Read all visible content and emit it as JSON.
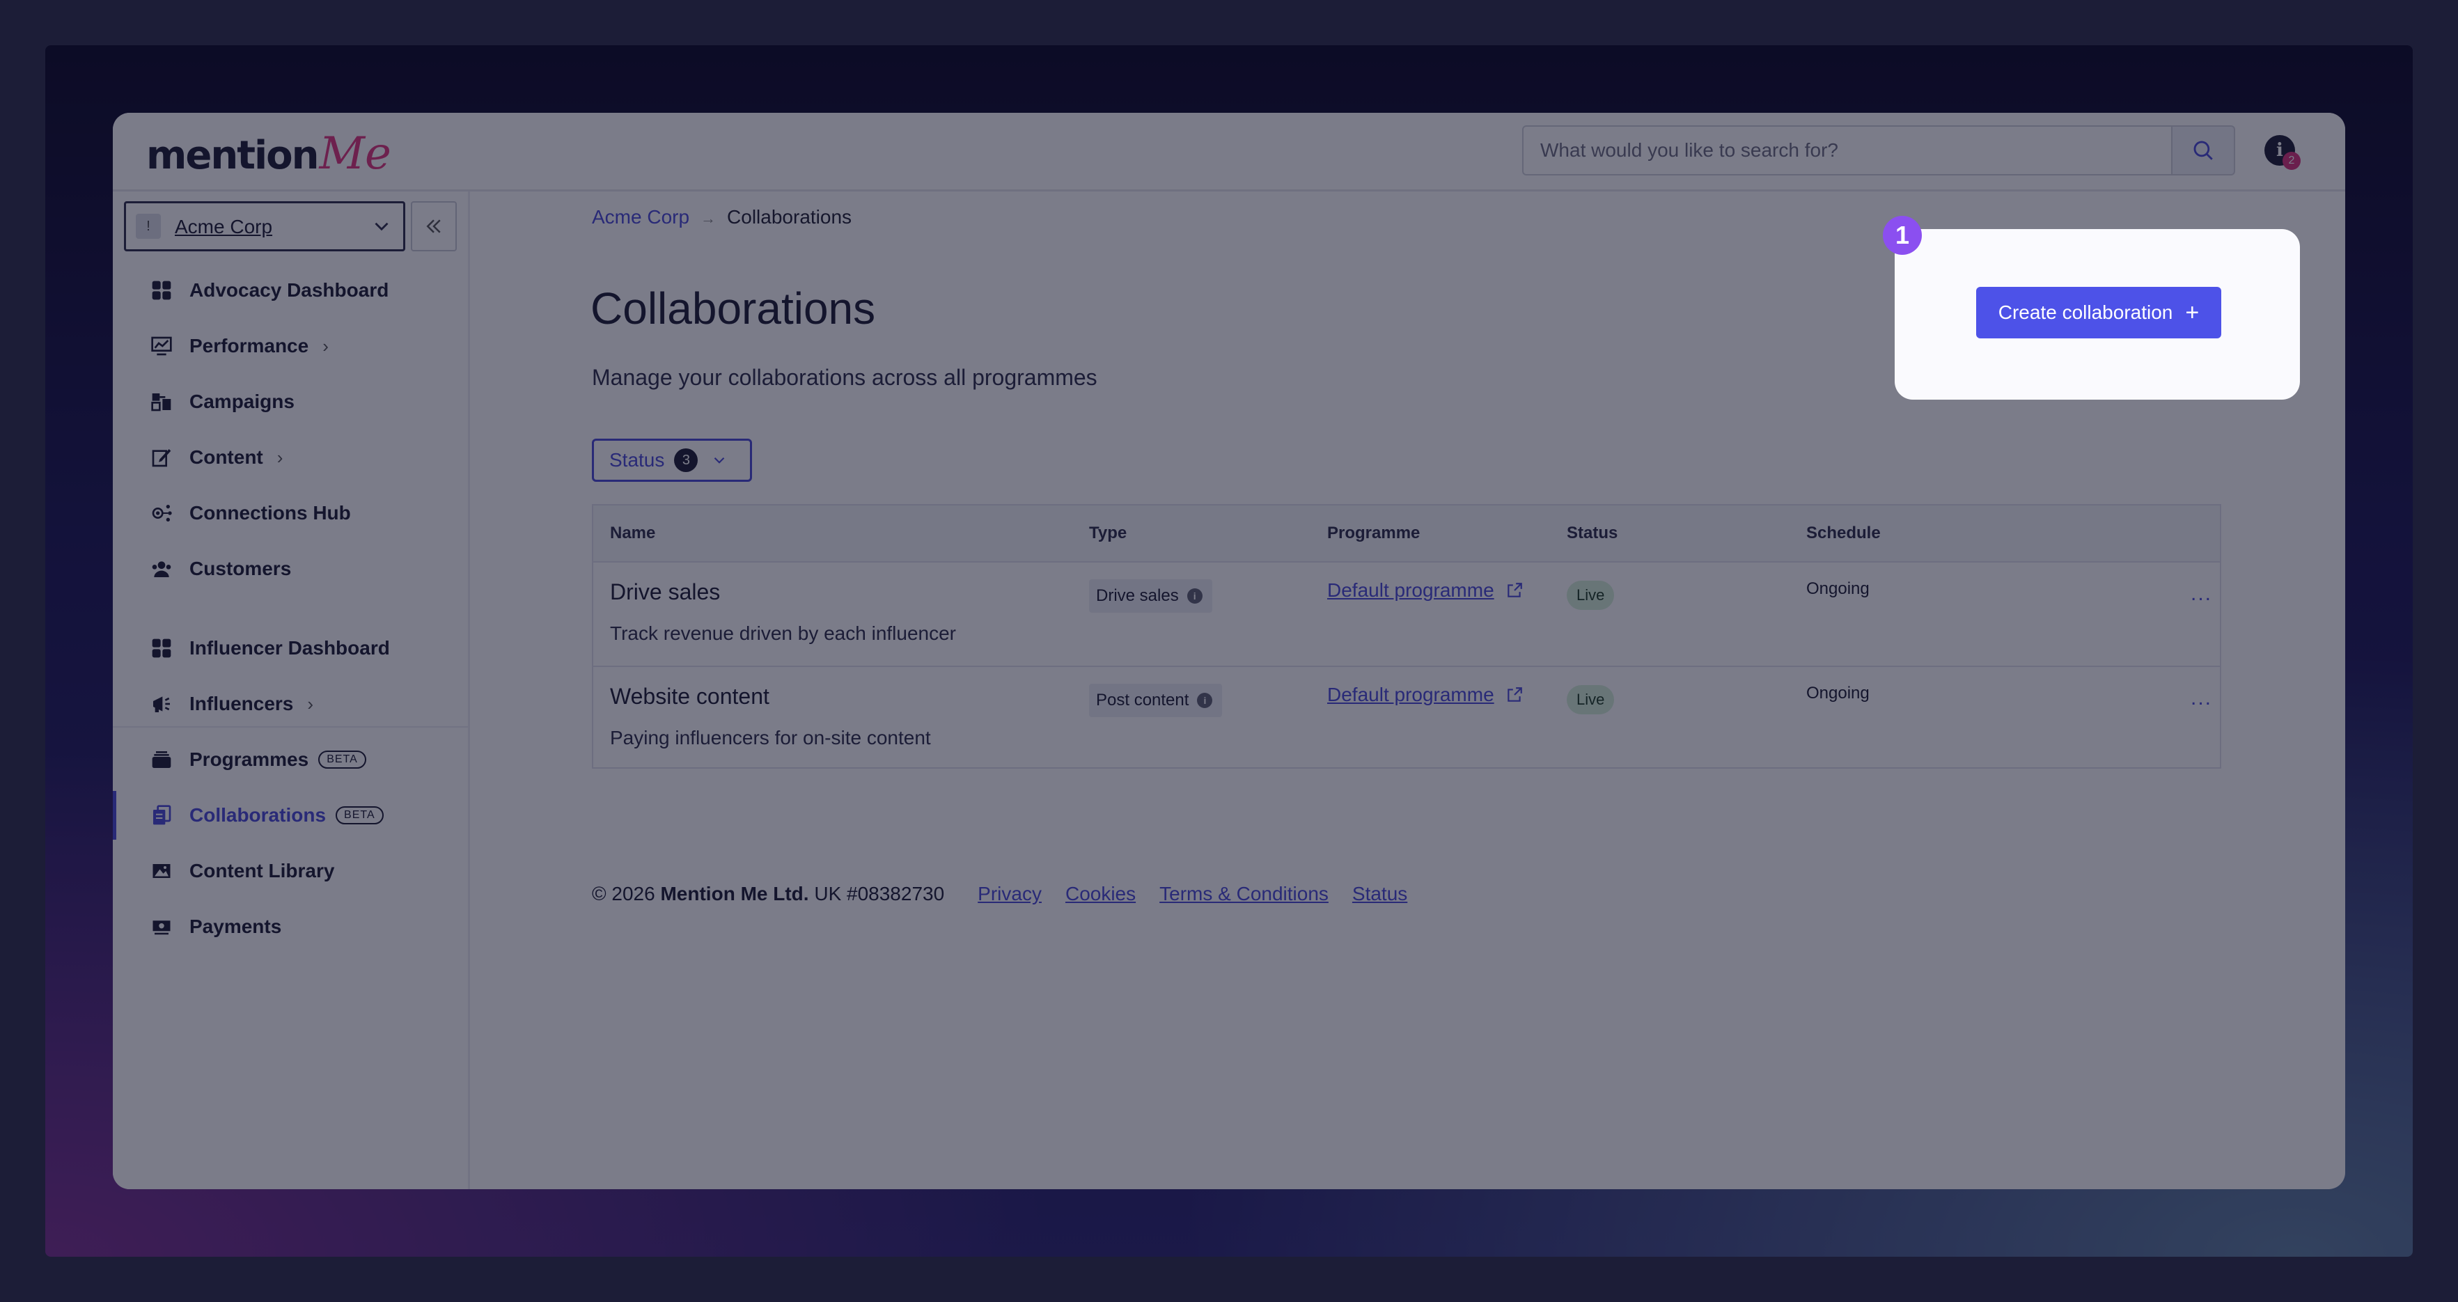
{
  "header": {
    "logo_main": "mention",
    "logo_accent": "Me",
    "search_placeholder": "What would you like to search for?",
    "info_icon": "i",
    "notification_count": "2"
  },
  "sidebar": {
    "org_initial": "!",
    "org_name": "Acme Corp",
    "items": [
      {
        "label": "Advocacy Dashboard",
        "icon": "grid-icon"
      },
      {
        "label": "Performance",
        "icon": "chart-board-icon",
        "chevron": "›"
      },
      {
        "label": "Campaigns",
        "icon": "campaigns-icon"
      },
      {
        "label": "Content",
        "icon": "edit-icon",
        "chevron": "›"
      },
      {
        "label": "Connections Hub",
        "icon": "connections-icon"
      },
      {
        "label": "Customers",
        "icon": "users-icon"
      },
      {
        "label": "Influencer Dashboard",
        "icon": "grid-icon"
      },
      {
        "label": "Influencers",
        "icon": "megaphone-icon",
        "chevron": "›"
      },
      {
        "label": "Programmes",
        "icon": "stack-icon",
        "badge": "BETA"
      },
      {
        "label": "Collaborations",
        "icon": "documents-icon",
        "badge": "BETA",
        "active": true
      },
      {
        "label": "Content Library",
        "icon": "image-icon"
      },
      {
        "label": "Payments",
        "icon": "money-icon"
      }
    ]
  },
  "breadcrumb": {
    "root": "Acme Corp",
    "sep": "→",
    "current": "Collaborations"
  },
  "main": {
    "title": "Collaborations",
    "subtitle": "Manage your collaborations across all programmes",
    "filter": {
      "label": "Status",
      "count": "3"
    },
    "create_label": "Create collaboration",
    "create_plus": "+"
  },
  "table": {
    "headers": [
      "Name",
      "Type",
      "Programme",
      "Status",
      "Schedule"
    ],
    "rows": [
      {
        "name": "Drive sales",
        "description": "Track revenue driven by each influencer",
        "type": "Drive sales",
        "programme": "Default programme",
        "status": "Live",
        "schedule": "Ongoing",
        "actions": "..."
      },
      {
        "name": "Website content",
        "description": "Paying influencers for on-site content",
        "type": "Post content",
        "programme": "Default programme",
        "status": "Live",
        "schedule": "Ongoing",
        "actions": "..."
      }
    ]
  },
  "footer": {
    "copyright_prefix": "© 2026",
    "company": "Mention Me Ltd.",
    "reg": "UK #08382730",
    "links": [
      "Privacy",
      "Cookies",
      "Terms & Conditions",
      "Status"
    ]
  },
  "tutorial": {
    "step": "1"
  },
  "colors": {
    "accent": "#4a4ad8",
    "brand_pink": "#e0377d",
    "step_badge": "#8b4ff0",
    "live_bg": "#d6f0d8"
  }
}
